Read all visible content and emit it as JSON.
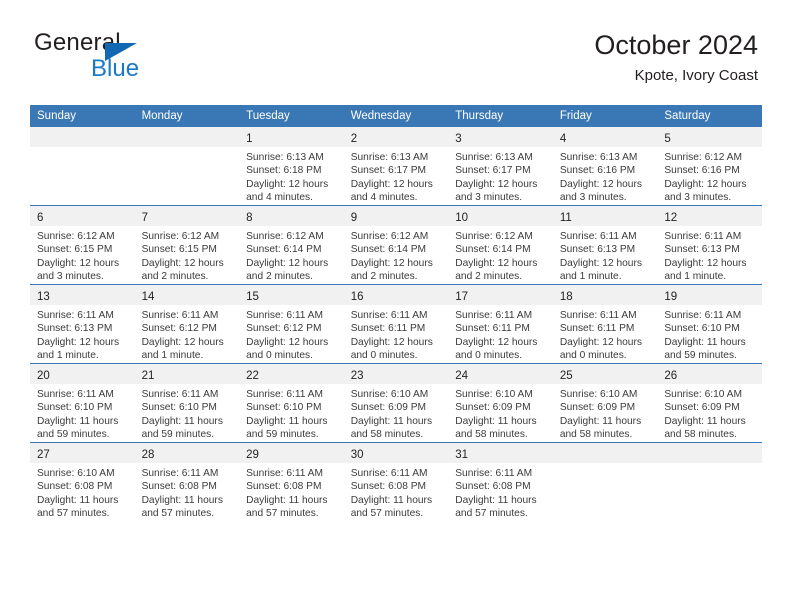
{
  "brand": {
    "name_top": "General",
    "name_bottom": "Blue",
    "colors": {
      "general": "#231f20",
      "blue": "#1a7ac4",
      "triangle": "#1268b3"
    }
  },
  "header": {
    "title": "October 2024",
    "subtitle": "Kpote, Ivory Coast"
  },
  "calendar": {
    "header_bg": "#3a78b5",
    "daynum_bg": "#f1f1f1",
    "weekday_headers": [
      "Sunday",
      "Monday",
      "Tuesday",
      "Wednesday",
      "Thursday",
      "Friday",
      "Saturday"
    ],
    "weeks": [
      [
        {
          "day": "",
          "lines": []
        },
        {
          "day": "",
          "lines": []
        },
        {
          "day": "1",
          "lines": [
            "Sunrise: 6:13 AM",
            "Sunset: 6:18 PM",
            "Daylight: 12 hours",
            "and 4 minutes."
          ]
        },
        {
          "day": "2",
          "lines": [
            "Sunrise: 6:13 AM",
            "Sunset: 6:17 PM",
            "Daylight: 12 hours",
            "and 4 minutes."
          ]
        },
        {
          "day": "3",
          "lines": [
            "Sunrise: 6:13 AM",
            "Sunset: 6:17 PM",
            "Daylight: 12 hours",
            "and 3 minutes."
          ]
        },
        {
          "day": "4",
          "lines": [
            "Sunrise: 6:13 AM",
            "Sunset: 6:16 PM",
            "Daylight: 12 hours",
            "and 3 minutes."
          ]
        },
        {
          "day": "5",
          "lines": [
            "Sunrise: 6:12 AM",
            "Sunset: 6:16 PM",
            "Daylight: 12 hours",
            "and 3 minutes."
          ]
        }
      ],
      [
        {
          "day": "6",
          "lines": [
            "Sunrise: 6:12 AM",
            "Sunset: 6:15 PM",
            "Daylight: 12 hours",
            "and 3 minutes."
          ]
        },
        {
          "day": "7",
          "lines": [
            "Sunrise: 6:12 AM",
            "Sunset: 6:15 PM",
            "Daylight: 12 hours",
            "and 2 minutes."
          ]
        },
        {
          "day": "8",
          "lines": [
            "Sunrise: 6:12 AM",
            "Sunset: 6:14 PM",
            "Daylight: 12 hours",
            "and 2 minutes."
          ]
        },
        {
          "day": "9",
          "lines": [
            "Sunrise: 6:12 AM",
            "Sunset: 6:14 PM",
            "Daylight: 12 hours",
            "and 2 minutes."
          ]
        },
        {
          "day": "10",
          "lines": [
            "Sunrise: 6:12 AM",
            "Sunset: 6:14 PM",
            "Daylight: 12 hours",
            "and 2 minutes."
          ]
        },
        {
          "day": "11",
          "lines": [
            "Sunrise: 6:11 AM",
            "Sunset: 6:13 PM",
            "Daylight: 12 hours",
            "and 1 minute."
          ]
        },
        {
          "day": "12",
          "lines": [
            "Sunrise: 6:11 AM",
            "Sunset: 6:13 PM",
            "Daylight: 12 hours",
            "and 1 minute."
          ]
        }
      ],
      [
        {
          "day": "13",
          "lines": [
            "Sunrise: 6:11 AM",
            "Sunset: 6:13 PM",
            "Daylight: 12 hours",
            "and 1 minute."
          ]
        },
        {
          "day": "14",
          "lines": [
            "Sunrise: 6:11 AM",
            "Sunset: 6:12 PM",
            "Daylight: 12 hours",
            "and 1 minute."
          ]
        },
        {
          "day": "15",
          "lines": [
            "Sunrise: 6:11 AM",
            "Sunset: 6:12 PM",
            "Daylight: 12 hours",
            "and 0 minutes."
          ]
        },
        {
          "day": "16",
          "lines": [
            "Sunrise: 6:11 AM",
            "Sunset: 6:11 PM",
            "Daylight: 12 hours",
            "and 0 minutes."
          ]
        },
        {
          "day": "17",
          "lines": [
            "Sunrise: 6:11 AM",
            "Sunset: 6:11 PM",
            "Daylight: 12 hours",
            "and 0 minutes."
          ]
        },
        {
          "day": "18",
          "lines": [
            "Sunrise: 6:11 AM",
            "Sunset: 6:11 PM",
            "Daylight: 12 hours",
            "and 0 minutes."
          ]
        },
        {
          "day": "19",
          "lines": [
            "Sunrise: 6:11 AM",
            "Sunset: 6:10 PM",
            "Daylight: 11 hours",
            "and 59 minutes."
          ]
        }
      ],
      [
        {
          "day": "20",
          "lines": [
            "Sunrise: 6:11 AM",
            "Sunset: 6:10 PM",
            "Daylight: 11 hours",
            "and 59 minutes."
          ]
        },
        {
          "day": "21",
          "lines": [
            "Sunrise: 6:11 AM",
            "Sunset: 6:10 PM",
            "Daylight: 11 hours",
            "and 59 minutes."
          ]
        },
        {
          "day": "22",
          "lines": [
            "Sunrise: 6:11 AM",
            "Sunset: 6:10 PM",
            "Daylight: 11 hours",
            "and 59 minutes."
          ]
        },
        {
          "day": "23",
          "lines": [
            "Sunrise: 6:10 AM",
            "Sunset: 6:09 PM",
            "Daylight: 11 hours",
            "and 58 minutes."
          ]
        },
        {
          "day": "24",
          "lines": [
            "Sunrise: 6:10 AM",
            "Sunset: 6:09 PM",
            "Daylight: 11 hours",
            "and 58 minutes."
          ]
        },
        {
          "day": "25",
          "lines": [
            "Sunrise: 6:10 AM",
            "Sunset: 6:09 PM",
            "Daylight: 11 hours",
            "and 58 minutes."
          ]
        },
        {
          "day": "26",
          "lines": [
            "Sunrise: 6:10 AM",
            "Sunset: 6:09 PM",
            "Daylight: 11 hours",
            "and 58 minutes."
          ]
        }
      ],
      [
        {
          "day": "27",
          "lines": [
            "Sunrise: 6:10 AM",
            "Sunset: 6:08 PM",
            "Daylight: 11 hours",
            "and 57 minutes."
          ]
        },
        {
          "day": "28",
          "lines": [
            "Sunrise: 6:11 AM",
            "Sunset: 6:08 PM",
            "Daylight: 11 hours",
            "and 57 minutes."
          ]
        },
        {
          "day": "29",
          "lines": [
            "Sunrise: 6:11 AM",
            "Sunset: 6:08 PM",
            "Daylight: 11 hours",
            "and 57 minutes."
          ]
        },
        {
          "day": "30",
          "lines": [
            "Sunrise: 6:11 AM",
            "Sunset: 6:08 PM",
            "Daylight: 11 hours",
            "and 57 minutes."
          ]
        },
        {
          "day": "31",
          "lines": [
            "Sunrise: 6:11 AM",
            "Sunset: 6:08 PM",
            "Daylight: 11 hours",
            "and 57 minutes."
          ]
        },
        {
          "day": "",
          "lines": []
        },
        {
          "day": "",
          "lines": []
        }
      ]
    ]
  }
}
